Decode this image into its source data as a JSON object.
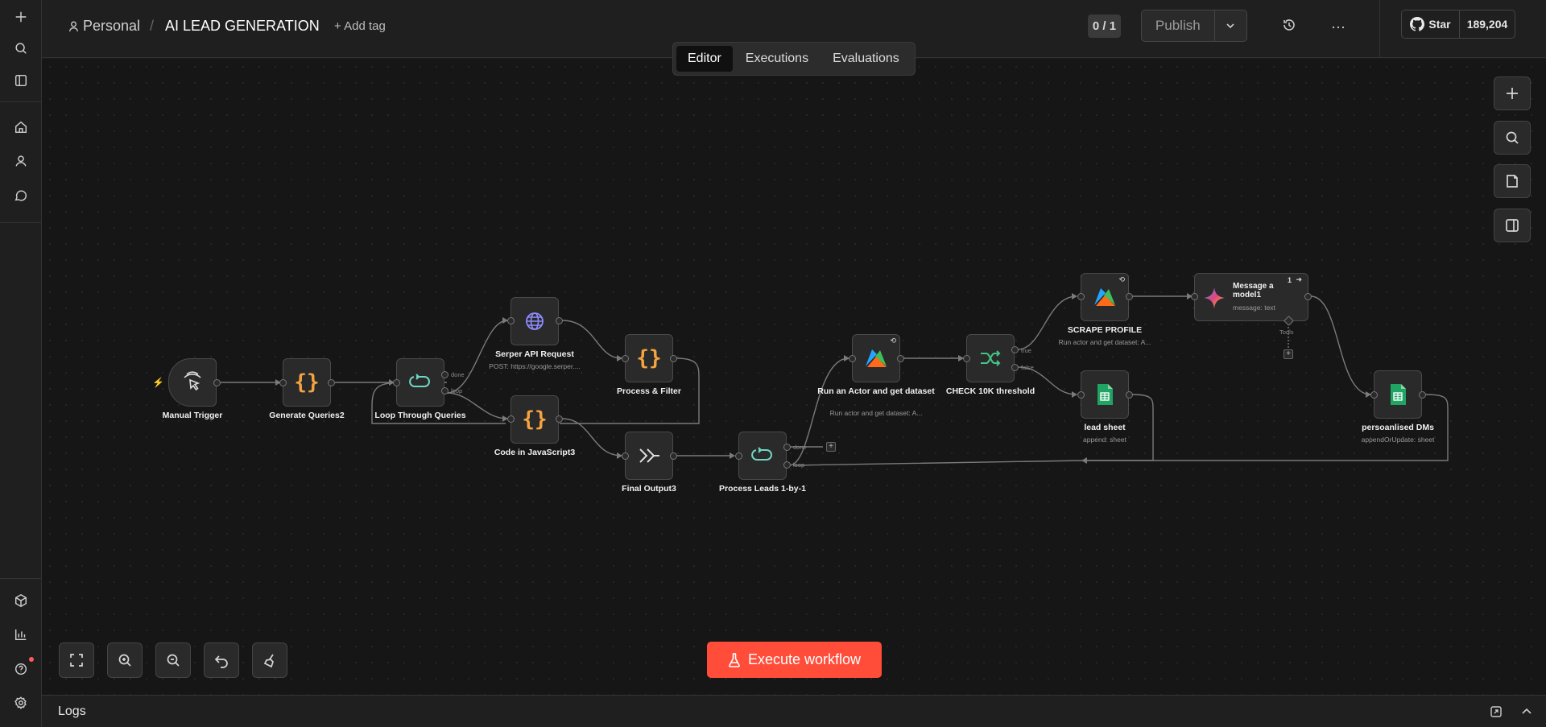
{
  "header": {
    "breadcrumb_project": "Personal",
    "breadcrumb_sep": "/",
    "workflow_title": "AI LEAD GENERATION",
    "add_tag": "+ Add tag",
    "version_counter": "0 / 1",
    "publish_label": "Publish",
    "github_star_label": "Star",
    "github_star_count": "189,204"
  },
  "tabs": [
    {
      "label": "Editor",
      "active": true
    },
    {
      "label": "Executions",
      "active": false
    },
    {
      "label": "Evaluations",
      "active": false
    }
  ],
  "nodes": {
    "manual_trigger": {
      "label": "Manual Trigger",
      "icon": "pointer-click-icon"
    },
    "generate_queries": {
      "label": "Generate Queries2",
      "icon": "code-braces-icon"
    },
    "loop_queries": {
      "label": "Loop Through Queries",
      "icon": "loop-icon",
      "out_done": "done",
      "out_loop": "loop"
    },
    "serper": {
      "label": "Serper API Request",
      "sub": "POST: https://google.serper....",
      "icon": "globe-icon"
    },
    "process_filter": {
      "label": "Process & Filter",
      "icon": "code-braces-icon"
    },
    "code_js": {
      "label": "Code in JavaScript3",
      "icon": "code-braces-icon"
    },
    "final_output": {
      "label": "Final Output3",
      "icon": "merge-arrows-icon"
    },
    "process_leads": {
      "label": "Process Leads 1-by-1",
      "icon": "loop-icon",
      "out_done": "done",
      "out_loop": "loop"
    },
    "run_actor": {
      "label": "Run an Actor and get dataset",
      "sub": "Run actor and get dataset: A...",
      "icon": "apify-icon"
    },
    "check_threshold": {
      "label": "CHECK 10K threshold",
      "icon": "if-branch-icon",
      "out_true": "true",
      "out_false": "false"
    },
    "scrape_profile": {
      "label": "SCRAPE PROFILE",
      "sub": "Run actor and get dataset: A...",
      "icon": "apify-icon"
    },
    "message_model": {
      "label": "Message a model1",
      "sub": "message: text",
      "icon": "gemini-icon",
      "badge": "1",
      "tools": "Tools"
    },
    "lead_sheet": {
      "label": "lead sheet",
      "sub": "append: sheet",
      "icon": "google-sheets-icon"
    },
    "personalised_dms": {
      "label": "persoanlised DMs",
      "sub": "appendOrUpdate: sheet",
      "icon": "google-sheets-icon"
    }
  },
  "execute_button": "Execute workflow",
  "logs_label": "Logs",
  "colors": {
    "accent": "#ff4d3a",
    "code_orange": "#f4a340",
    "loop_teal": "#6fd6c2",
    "globe_purple": "#8e8cff",
    "sheets_green": "#1fa463",
    "if_green": "#43c487"
  }
}
